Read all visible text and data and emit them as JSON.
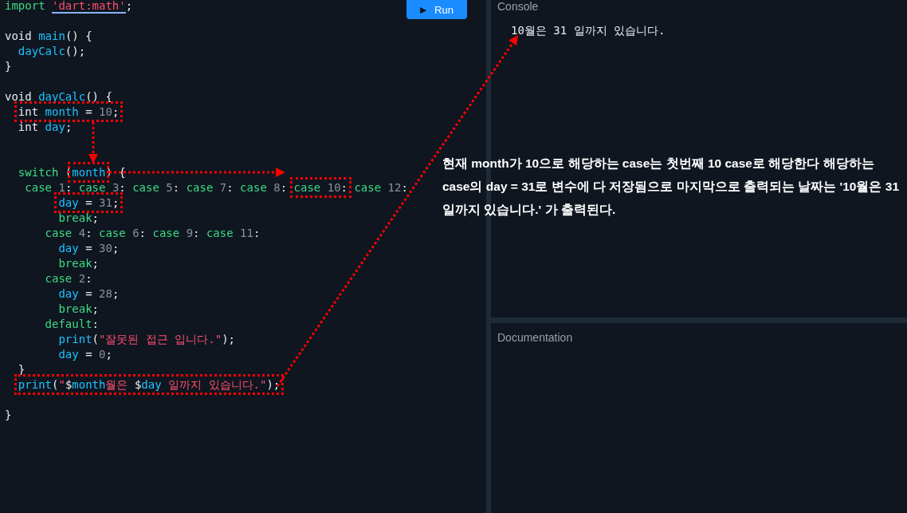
{
  "editor": {
    "run_button": {
      "label": "Run",
      "icon": "▶"
    },
    "lines": [
      {
        "kind": "code",
        "segments": [
          {
            "kind": "kw",
            "text": "import "
          },
          {
            "kind": "uri",
            "text": "'dart:math'"
          },
          {
            "kind": "plain",
            "text": ";"
          }
        ]
      },
      {
        "kind": "blank"
      },
      {
        "kind": "code",
        "segments": [
          {
            "kind": "plain",
            "text": "void "
          },
          {
            "kind": "fn",
            "text": "main"
          },
          {
            "kind": "plain",
            "text": "() {"
          }
        ]
      },
      {
        "kind": "code",
        "segments": [
          {
            "kind": "fn",
            "text": "  dayCalc"
          },
          {
            "kind": "plain",
            "text": "();"
          }
        ]
      },
      {
        "kind": "code",
        "segments": [
          {
            "kind": "plain",
            "text": "}"
          }
        ]
      },
      {
        "kind": "blank"
      },
      {
        "kind": "code",
        "segments": [
          {
            "kind": "plain",
            "text": "void "
          },
          {
            "kind": "fn",
            "text": "dayCalc"
          },
          {
            "kind": "plain",
            "text": "() {"
          }
        ]
      },
      {
        "kind": "code",
        "segments": [
          {
            "kind": "highlight",
            "segments": [
              {
                "kind": "plain",
                "text": "  int "
              },
              {
                "kind": "fn",
                "text": "month"
              },
              {
                "kind": "plain",
                "text": " = "
              },
              {
                "kind": "num",
                "text": "10"
              },
              {
                "kind": "plain",
                "text": ";"
              }
            ]
          }
        ]
      },
      {
        "kind": "code",
        "segments": [
          {
            "kind": "plain",
            "text": "  int "
          },
          {
            "kind": "fn",
            "text": "day"
          },
          {
            "kind": "plain",
            "text": ";"
          }
        ]
      },
      {
        "kind": "blank"
      },
      {
        "kind": "blank"
      },
      {
        "kind": "code",
        "segments": [
          {
            "kind": "kw",
            "text": "  switch "
          },
          {
            "kind": "plain",
            "text": "("
          },
          {
            "kind": "highlight",
            "segments": [
              {
                "kind": "fn",
                "text": "month"
              }
            ]
          },
          {
            "kind": "plain",
            "text": ") {"
          }
        ]
      },
      {
        "kind": "code",
        "segments": [
          {
            "kind": "kw",
            "text": "   case "
          },
          {
            "kind": "num",
            "text": "1"
          },
          {
            "kind": "plain",
            "text": ": "
          },
          {
            "kind": "kw",
            "text": "case "
          },
          {
            "kind": "num",
            "text": "3"
          },
          {
            "kind": "plain",
            "text": ": "
          },
          {
            "kind": "kw",
            "text": "case "
          },
          {
            "kind": "num",
            "text": "5"
          },
          {
            "kind": "plain",
            "text": ": "
          },
          {
            "kind": "kw",
            "text": "case "
          },
          {
            "kind": "num",
            "text": "7"
          },
          {
            "kind": "plain",
            "text": ": "
          },
          {
            "kind": "kw",
            "text": "case "
          },
          {
            "kind": "num",
            "text": "8"
          },
          {
            "kind": "plain",
            "text": ": "
          },
          {
            "kind": "highlight",
            "segments": [
              {
                "kind": "kw",
                "text": "case "
              },
              {
                "kind": "num",
                "text": "10"
              },
              {
                "kind": "plain",
                "text": ":"
              }
            ]
          },
          {
            "kind": "kw",
            "text": " case "
          },
          {
            "kind": "num",
            "text": "12"
          },
          {
            "kind": "plain",
            "text": ":"
          }
        ]
      },
      {
        "kind": "code",
        "segments": [
          {
            "kind": "highlight",
            "segments": [
              {
                "kind": "fn",
                "text": "        day"
              },
              {
                "kind": "plain",
                "text": " = "
              },
              {
                "kind": "num",
                "text": "31"
              },
              {
                "kind": "plain",
                "text": ";"
              }
            ]
          }
        ]
      },
      {
        "kind": "code",
        "segments": [
          {
            "kind": "kw",
            "text": "        break"
          },
          {
            "kind": "plain",
            "text": ";"
          }
        ]
      },
      {
        "kind": "code",
        "segments": [
          {
            "kind": "kw",
            "text": "      case "
          },
          {
            "kind": "num",
            "text": "4"
          },
          {
            "kind": "plain",
            "text": ": "
          },
          {
            "kind": "kw",
            "text": "case "
          },
          {
            "kind": "num",
            "text": "6"
          },
          {
            "kind": "plain",
            "text": ": "
          },
          {
            "kind": "kw",
            "text": "case "
          },
          {
            "kind": "num",
            "text": "9"
          },
          {
            "kind": "plain",
            "text": ": "
          },
          {
            "kind": "kw",
            "text": "case "
          },
          {
            "kind": "num",
            "text": "11"
          },
          {
            "kind": "plain",
            "text": ":"
          }
        ]
      },
      {
        "kind": "code",
        "segments": [
          {
            "kind": "fn",
            "text": "        day"
          },
          {
            "kind": "plain",
            "text": " = "
          },
          {
            "kind": "num",
            "text": "30"
          },
          {
            "kind": "plain",
            "text": ";"
          }
        ]
      },
      {
        "kind": "code",
        "segments": [
          {
            "kind": "kw",
            "text": "        break"
          },
          {
            "kind": "plain",
            "text": ";"
          }
        ]
      },
      {
        "kind": "code",
        "segments": [
          {
            "kind": "kw",
            "text": "      case "
          },
          {
            "kind": "num",
            "text": "2"
          },
          {
            "kind": "plain",
            "text": ":"
          }
        ]
      },
      {
        "kind": "code",
        "segments": [
          {
            "kind": "fn",
            "text": "        day"
          },
          {
            "kind": "plain",
            "text": " = "
          },
          {
            "kind": "num",
            "text": "28"
          },
          {
            "kind": "plain",
            "text": ";"
          }
        ]
      },
      {
        "kind": "code",
        "segments": [
          {
            "kind": "kw",
            "text": "        break"
          },
          {
            "kind": "plain",
            "text": ";"
          }
        ]
      },
      {
        "kind": "code",
        "segments": [
          {
            "kind": "kw",
            "text": "      default"
          },
          {
            "kind": "plain",
            "text": ":"
          }
        ]
      },
      {
        "kind": "code",
        "segments": [
          {
            "kind": "fn",
            "text": "        print"
          },
          {
            "kind": "plain",
            "text": "("
          },
          {
            "kind": "str",
            "text": "\"잘못된 접근 입니다.\""
          },
          {
            "kind": "plain",
            "text": ");"
          }
        ]
      },
      {
        "kind": "code",
        "segments": [
          {
            "kind": "fn",
            "text": "        day"
          },
          {
            "kind": "plain",
            "text": " = "
          },
          {
            "kind": "num",
            "text": "0"
          },
          {
            "kind": "plain",
            "text": ";"
          }
        ]
      },
      {
        "kind": "code",
        "segments": [
          {
            "kind": "plain",
            "text": "  }"
          }
        ]
      },
      {
        "kind": "code",
        "segments": [
          {
            "kind": "highlight",
            "segments": [
              {
                "kind": "fn",
                "text": "  print"
              },
              {
                "kind": "plain",
                "text": "("
              },
              {
                "kind": "str",
                "text": "\""
              },
              {
                "kind": "plain",
                "text": "$"
              },
              {
                "kind": "fn",
                "text": "month"
              },
              {
                "kind": "str",
                "text": "월은 "
              },
              {
                "kind": "plain",
                "text": "$"
              },
              {
                "kind": "fn",
                "text": "day"
              },
              {
                "kind": "str",
                "text": " 일까지 있습니다.\""
              },
              {
                "kind": "plain",
                "text": ");"
              }
            ]
          }
        ]
      },
      {
        "kind": "blank"
      },
      {
        "kind": "code",
        "segments": [
          {
            "kind": "plain",
            "text": "}"
          }
        ]
      }
    ]
  },
  "console": {
    "title": "Console",
    "output": "10월은 31 일까지 있습니다."
  },
  "documentation": {
    "title": "Documentation"
  },
  "annotation": {
    "note": "현재 month가 10으로 해당하는 case는 첫번째 10 case로 해당한다 해당하는 case의 day = 31로 변수에 다 저장됨으로 마지막으로 출력되는 날짜는 '10월은 31 일까지 있습니다.' 가 출력된다."
  }
}
